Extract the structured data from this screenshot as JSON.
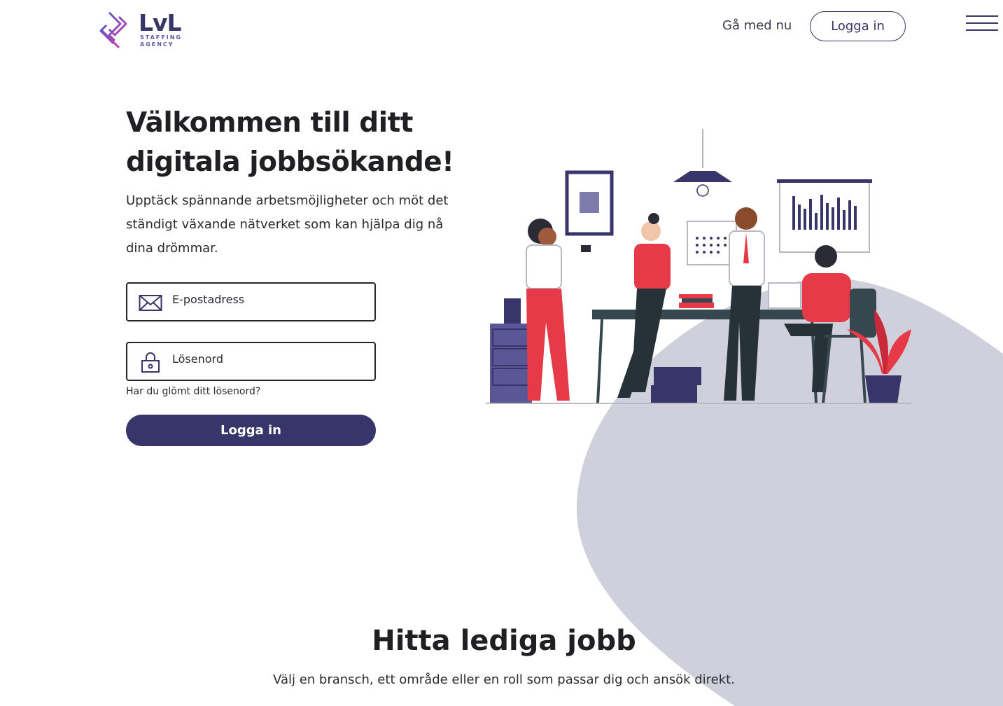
{
  "brand": {
    "name": "LvL",
    "tagline_line1": "STAFFING",
    "tagline_line2": "AGENCY"
  },
  "header": {
    "join_label": "Gå med nu",
    "login_label": "Logga in"
  },
  "hero": {
    "title": "Välkommen till ditt digitala jobbsökande!",
    "description": "Upptäck spännande arbetsmöjligheter och möt det ständigt växande nätverket som kan hjälpa dig nå dina drömmar."
  },
  "login_form": {
    "email_placeholder": "E-postadress",
    "password_placeholder": "Lösenord",
    "forgot_label": "Har du glömt ditt lösenord?",
    "submit_label": "Logga in"
  },
  "jobs_section": {
    "title": "Hitta lediga jobb",
    "subtitle": "Välj en bransch, ett område eller en roll som passar dig och ansök direkt."
  },
  "colors": {
    "primary": "#38356a",
    "blob": "#d0cfdc",
    "accent": "#e63a48"
  }
}
